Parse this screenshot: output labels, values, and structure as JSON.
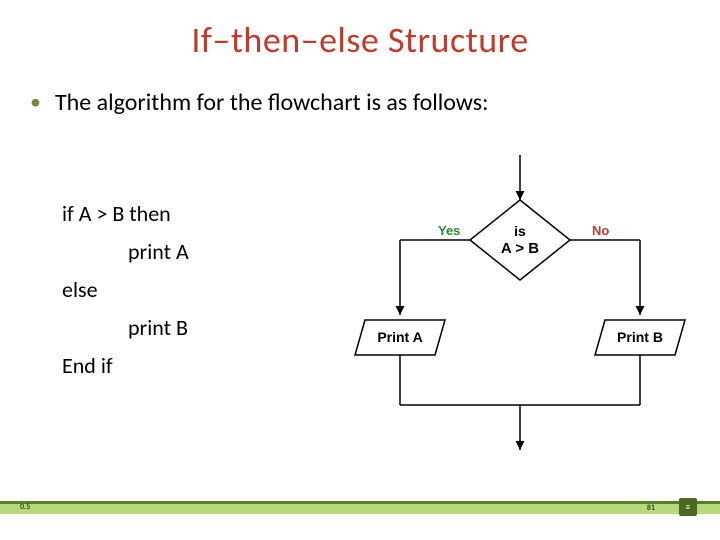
{
  "title": "If–then–else Structure",
  "bullet": "The algorithm for the flowchart is as follows:",
  "pseudo": {
    "l1": "if A > B then",
    "l2": "print A",
    "l3": "else",
    "l4": "print B",
    "l5": "End if"
  },
  "flow": {
    "yes": "Yes",
    "no": "No",
    "cond1": "is",
    "cond2": "A > B",
    "branch_yes": "Print A",
    "branch_no": "Print B"
  },
  "footer": {
    "version": "0.5",
    "page": "81",
    "badge": "≡"
  },
  "chart_data": {
    "type": "flowchart",
    "title": "If–then–else Structure",
    "nodes": [
      {
        "id": "entry",
        "type": "connector",
        "label": ""
      },
      {
        "id": "decision",
        "type": "decision",
        "label": "is A > B"
      },
      {
        "id": "printA",
        "type": "process",
        "label": "Print A"
      },
      {
        "id": "printB",
        "type": "process",
        "label": "Print B"
      },
      {
        "id": "merge",
        "type": "connector",
        "label": ""
      },
      {
        "id": "exit",
        "type": "connector",
        "label": ""
      }
    ],
    "edges": [
      {
        "from": "entry",
        "to": "decision",
        "label": ""
      },
      {
        "from": "decision",
        "to": "printA",
        "label": "Yes"
      },
      {
        "from": "decision",
        "to": "printB",
        "label": "No"
      },
      {
        "from": "printA",
        "to": "merge",
        "label": ""
      },
      {
        "from": "printB",
        "to": "merge",
        "label": ""
      },
      {
        "from": "merge",
        "to": "exit",
        "label": ""
      }
    ],
    "pseudocode": [
      "if A > B then",
      "    print A",
      "else",
      "    print B",
      "End if"
    ]
  }
}
